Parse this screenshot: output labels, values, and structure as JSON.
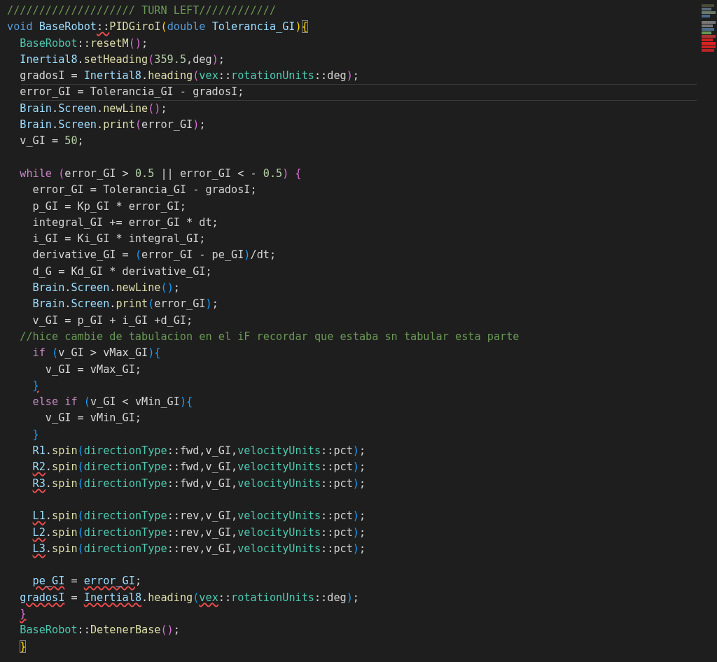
{
  "editor": {
    "lines": [
      {
        "kind": "top",
        "current": false,
        "tokens": [
          {
            "t": "//////////////////// TURN LEFT////////////",
            "kind": "comment"
          }
        ]
      },
      {
        "kind": "top",
        "current": false,
        "tokens": [
          {
            "t": "void",
            "kind": "keyword"
          },
          {
            "t": " BaseRobot",
            "kind": "variable"
          },
          {
            "t": "::",
            "kind": "plain",
            "error": true
          },
          {
            "t": "PIDGiroI",
            "kind": "function"
          },
          {
            "t": "(",
            "kind": "bracket1"
          },
          {
            "t": "double",
            "kind": "keyword"
          },
          {
            "t": " Tolerancia_GI",
            "kind": "variable"
          },
          {
            "t": ")",
            "kind": "bracket1"
          },
          {
            "t": "{",
            "kind": "bracket1",
            "matched": true
          }
        ]
      },
      {
        "kind": "body",
        "current": false,
        "tokens": [
          {
            "t": "BaseRobot",
            "kind": "type"
          },
          {
            "t": "::",
            "kind": "plain"
          },
          {
            "t": "resetM",
            "kind": "function"
          },
          {
            "t": "()",
            "kind": "bracket2"
          },
          {
            "t": ";",
            "kind": "plain"
          }
        ]
      },
      {
        "kind": "body",
        "current": false,
        "tokens": [
          {
            "t": "Inertial8",
            "kind": "variable"
          },
          {
            "t": ".",
            "kind": "plain"
          },
          {
            "t": "setHeading",
            "kind": "function"
          },
          {
            "t": "(",
            "kind": "bracket2"
          },
          {
            "t": "359.5",
            "kind": "number"
          },
          {
            "t": ",deg",
            "kind": "plain"
          },
          {
            "t": ")",
            "kind": "bracket2"
          },
          {
            "t": ";",
            "kind": "plain"
          }
        ]
      },
      {
        "kind": "body",
        "current": false,
        "tokens": [
          {
            "t": "gradosI = ",
            "kind": "plain"
          },
          {
            "t": "Inertial8",
            "kind": "variable"
          },
          {
            "t": ".",
            "kind": "plain"
          },
          {
            "t": "heading",
            "kind": "function"
          },
          {
            "t": "(",
            "kind": "bracket2"
          },
          {
            "t": "vex",
            "kind": "type"
          },
          {
            "t": "::",
            "kind": "plain"
          },
          {
            "t": "rotationUnits",
            "kind": "type"
          },
          {
            "t": "::deg",
            "kind": "plain"
          },
          {
            "t": ")",
            "kind": "bracket2"
          },
          {
            "t": ";",
            "kind": "plain"
          }
        ]
      },
      {
        "kind": "body",
        "current": true,
        "tokens": [
          {
            "t": "error_GI = Tolerancia_GI - gradosI;",
            "kind": "plain"
          }
        ]
      },
      {
        "kind": "body",
        "current": false,
        "tokens": [
          {
            "t": "Brain",
            "kind": "variable"
          },
          {
            "t": ".",
            "kind": "plain"
          },
          {
            "t": "Screen",
            "kind": "variable"
          },
          {
            "t": ".",
            "kind": "plain"
          },
          {
            "t": "newLine",
            "kind": "function"
          },
          {
            "t": "()",
            "kind": "bracket2"
          },
          {
            "t": ";",
            "kind": "plain"
          }
        ]
      },
      {
        "kind": "body",
        "current": false,
        "tokens": [
          {
            "t": "Brain",
            "kind": "variable"
          },
          {
            "t": ".",
            "kind": "plain"
          },
          {
            "t": "Screen",
            "kind": "variable"
          },
          {
            "t": ".",
            "kind": "plain"
          },
          {
            "t": "print",
            "kind": "function"
          },
          {
            "t": "(",
            "kind": "bracket2"
          },
          {
            "t": "error_GI",
            "kind": "plain"
          },
          {
            "t": ")",
            "kind": "bracket2"
          },
          {
            "t": ";",
            "kind": "plain"
          }
        ]
      },
      {
        "kind": "body",
        "current": false,
        "tokens": [
          {
            "t": "v_GI = ",
            "kind": "plain"
          },
          {
            "t": "50",
            "kind": "number"
          },
          {
            "t": ";",
            "kind": "plain"
          }
        ]
      },
      {
        "kind": "top",
        "current": false
      },
      {
        "kind": "body",
        "current": false,
        "tokens": [
          {
            "t": "while",
            "kind": "control"
          },
          {
            "t": " (",
            "kind": "bracket2"
          },
          {
            "t": "error_GI > ",
            "kind": "plain"
          },
          {
            "t": "0.5",
            "kind": "number"
          },
          {
            "t": " || error_GI < - ",
            "kind": "plain"
          },
          {
            "t": "0.5",
            "kind": "number"
          },
          {
            "t": ")",
            "kind": "bracket2"
          },
          {
            "t": " {",
            "kind": "bracket2"
          }
        ]
      },
      {
        "kind": "loop",
        "current": false,
        "tokens": [
          {
            "t": "error_GI = Tolerancia_GI - gradosI;",
            "kind": "plain"
          }
        ]
      },
      {
        "kind": "loop",
        "current": false,
        "tokens": [
          {
            "t": "p_GI = Kp_GI * error_GI;",
            "kind": "plain"
          }
        ]
      },
      {
        "kind": "loop",
        "current": false,
        "tokens": [
          {
            "t": "integral_GI += error_GI * dt;",
            "kind": "plain"
          }
        ]
      },
      {
        "kind": "loop",
        "current": false,
        "tokens": [
          {
            "t": "i_GI = Ki_GI * integral_GI;",
            "kind": "plain"
          }
        ]
      },
      {
        "kind": "loop",
        "current": false,
        "tokens": [
          {
            "t": "derivative_GI = ",
            "kind": "plain"
          },
          {
            "t": "(",
            "kind": "bracket3"
          },
          {
            "t": "error_GI - pe_GI",
            "kind": "plain"
          },
          {
            "t": ")",
            "kind": "bracket3"
          },
          {
            "t": "/dt;",
            "kind": "plain"
          }
        ]
      },
      {
        "kind": "loop",
        "current": false,
        "tokens": [
          {
            "t": "d_G = Kd_GI * derivative_GI;",
            "kind": "plain"
          }
        ]
      },
      {
        "kind": "loop",
        "current": false,
        "tokens": [
          {
            "t": "Brain",
            "kind": "variable"
          },
          {
            "t": ".",
            "kind": "plain"
          },
          {
            "t": "Screen",
            "kind": "variable"
          },
          {
            "t": ".",
            "kind": "plain"
          },
          {
            "t": "newLine",
            "kind": "function"
          },
          {
            "t": "()",
            "kind": "bracket3"
          },
          {
            "t": ";",
            "kind": "plain"
          }
        ]
      },
      {
        "kind": "loop",
        "current": false,
        "tokens": [
          {
            "t": "Brain",
            "kind": "variable"
          },
          {
            "t": ".",
            "kind": "plain"
          },
          {
            "t": "Screen",
            "kind": "variable"
          },
          {
            "t": ".",
            "kind": "plain"
          },
          {
            "t": "print",
            "kind": "function"
          },
          {
            "t": "(",
            "kind": "bracket3"
          },
          {
            "t": "error_GI",
            "kind": "plain"
          },
          {
            "t": ")",
            "kind": "bracket3"
          },
          {
            "t": ";",
            "kind": "plain"
          }
        ]
      },
      {
        "kind": "loop",
        "current": false,
        "tokens": [
          {
            "t": "v_GI = p_GI + i_GI +d_GI;",
            "kind": "plain"
          }
        ]
      },
      {
        "kind": "body",
        "current": false,
        "tokens": [
          {
            "t": "//hice cambie de tabulacion en el iF recordar que estaba sn tabular esta parte",
            "kind": "comment"
          }
        ]
      },
      {
        "kind": "loop",
        "current": false,
        "tokens": [
          {
            "t": "if",
            "kind": "control"
          },
          {
            "t": " (",
            "kind": "bracket3"
          },
          {
            "t": "v_GI > vMax_GI",
            "kind": "plain"
          },
          {
            "t": ")",
            "kind": "bracket3"
          },
          {
            "t": "{",
            "kind": "bracket3"
          }
        ]
      },
      {
        "kind": "branch",
        "current": false,
        "tokens": [
          {
            "t": "v_GI = vMax_GI;",
            "kind": "plain"
          }
        ]
      },
      {
        "kind": "loop",
        "current": false,
        "tokens": [
          {
            "t": "}",
            "kind": "bracket3",
            "error": true
          }
        ]
      },
      {
        "kind": "loop",
        "current": false,
        "tokens": [
          {
            "t": "else if",
            "kind": "control"
          },
          {
            "t": " (",
            "kind": "bracket3"
          },
          {
            "t": "v_GI < vMin_GI",
            "kind": "plain"
          },
          {
            "t": ")",
            "kind": "bracket3"
          },
          {
            "t": "{",
            "kind": "bracket3"
          }
        ]
      },
      {
        "kind": "branch",
        "current": false,
        "tokens": [
          {
            "t": "v_GI = vMin_GI;",
            "kind": "plain"
          }
        ]
      },
      {
        "kind": "loop",
        "current": false,
        "tokens": [
          {
            "t": "}",
            "kind": "bracket3"
          }
        ]
      },
      {
        "kind": "loop",
        "current": false,
        "tokens": [
          {
            "t": "R1",
            "kind": "variable"
          },
          {
            "t": ".",
            "kind": "plain"
          },
          {
            "t": "spin",
            "kind": "function"
          },
          {
            "t": "(",
            "kind": "bracket3"
          },
          {
            "t": "directionType",
            "kind": "type"
          },
          {
            "t": "::fwd,v_GI,",
            "kind": "plain"
          },
          {
            "t": "velocityUnits",
            "kind": "type"
          },
          {
            "t": "::pct",
            "kind": "plain"
          },
          {
            "t": ")",
            "kind": "bracket3"
          },
          {
            "t": ";",
            "kind": "plain"
          }
        ]
      },
      {
        "kind": "loop",
        "current": false,
        "tokens": [
          {
            "t": "R2",
            "kind": "variable",
            "error": true
          },
          {
            "t": ".",
            "kind": "plain"
          },
          {
            "t": "spin",
            "kind": "function"
          },
          {
            "t": "(",
            "kind": "bracket3"
          },
          {
            "t": "directionType",
            "kind": "type"
          },
          {
            "t": "::fwd,v_GI,",
            "kind": "plain"
          },
          {
            "t": "velocityUnits",
            "kind": "type"
          },
          {
            "t": "::pct",
            "kind": "plain"
          },
          {
            "t": ")",
            "kind": "bracket3"
          },
          {
            "t": ";",
            "kind": "plain"
          }
        ]
      },
      {
        "kind": "loop",
        "current": false,
        "tokens": [
          {
            "t": "R3",
            "kind": "variable",
            "error": true
          },
          {
            "t": ".",
            "kind": "plain"
          },
          {
            "t": "spin",
            "kind": "function"
          },
          {
            "t": "(",
            "kind": "bracket3"
          },
          {
            "t": "directionType",
            "kind": "type"
          },
          {
            "t": "::fwd,v_GI,",
            "kind": "plain"
          },
          {
            "t": "velocityUnits",
            "kind": "type"
          },
          {
            "t": "::pct",
            "kind": "plain"
          },
          {
            "t": ")",
            "kind": "bracket3"
          },
          {
            "t": ";",
            "kind": "plain"
          }
        ]
      },
      {
        "kind": "top",
        "current": false
      },
      {
        "kind": "loop",
        "current": false,
        "tokens": [
          {
            "t": "L1",
            "kind": "variable",
            "error": true
          },
          {
            "t": ".",
            "kind": "plain"
          },
          {
            "t": "spin",
            "kind": "function"
          },
          {
            "t": "(",
            "kind": "bracket3"
          },
          {
            "t": "directionType",
            "kind": "type"
          },
          {
            "t": "::rev,v_GI,",
            "kind": "plain"
          },
          {
            "t": "velocityUnits",
            "kind": "type"
          },
          {
            "t": "::pct",
            "kind": "plain"
          },
          {
            "t": ")",
            "kind": "bracket3"
          },
          {
            "t": ";",
            "kind": "plain"
          }
        ]
      },
      {
        "kind": "loop",
        "current": false,
        "tokens": [
          {
            "t": "L2",
            "kind": "variable",
            "error": true
          },
          {
            "t": ".",
            "kind": "plain"
          },
          {
            "t": "spin",
            "kind": "function"
          },
          {
            "t": "(",
            "kind": "bracket3"
          },
          {
            "t": "directionType",
            "kind": "type"
          },
          {
            "t": "::rev,v_GI,",
            "kind": "plain"
          },
          {
            "t": "velocityUnits",
            "kind": "type"
          },
          {
            "t": "::pct",
            "kind": "plain"
          },
          {
            "t": ")",
            "kind": "bracket3"
          },
          {
            "t": ";",
            "kind": "plain"
          }
        ]
      },
      {
        "kind": "loop",
        "current": false,
        "tokens": [
          {
            "t": "L3",
            "kind": "variable",
            "error": true
          },
          {
            "t": ".",
            "kind": "plain"
          },
          {
            "t": "spin",
            "kind": "function"
          },
          {
            "t": "(",
            "kind": "bracket3"
          },
          {
            "t": "directionType",
            "kind": "type"
          },
          {
            "t": "::rev,v_GI,",
            "kind": "plain"
          },
          {
            "t": "velocityUnits",
            "kind": "type"
          },
          {
            "t": "::pct",
            "kind": "plain"
          },
          {
            "t": ")",
            "kind": "bracket3"
          },
          {
            "t": ";",
            "kind": "plain"
          }
        ]
      },
      {
        "kind": "top",
        "current": false
      },
      {
        "kind": "loop",
        "current": false,
        "tokens": [
          {
            "t": "pe_GI",
            "kind": "variable",
            "error": true
          },
          {
            "t": " = ",
            "kind": "plain"
          },
          {
            "t": "error_GI",
            "kind": "variable",
            "error": true
          },
          {
            "t": ";",
            "kind": "plain"
          }
        ]
      },
      {
        "kind": "body",
        "current": false,
        "tokens": [
          {
            "t": "gradosI",
            "kind": "variable",
            "error": true
          },
          {
            "t": " = ",
            "kind": "plain"
          },
          {
            "t": "Inertial8",
            "kind": "variable",
            "error": true
          },
          {
            "t": ".",
            "kind": "plain"
          },
          {
            "t": "heading",
            "kind": "function"
          },
          {
            "t": "(",
            "kind": "bracket3"
          },
          {
            "t": "vex",
            "kind": "type",
            "error": true
          },
          {
            "t": "::",
            "kind": "plain"
          },
          {
            "t": "rotationUnits",
            "kind": "type"
          },
          {
            "t": "::deg",
            "kind": "plain"
          },
          {
            "t": ")",
            "kind": "bracket3"
          },
          {
            "t": ";",
            "kind": "plain"
          }
        ]
      },
      {
        "kind": "body",
        "current": false,
        "tokens": [
          {
            "t": "}",
            "kind": "bracket2",
            "error": true
          }
        ]
      },
      {
        "kind": "body",
        "current": false,
        "tokens": [
          {
            "t": "BaseRobot",
            "kind": "type"
          },
          {
            "t": "::",
            "kind": "plain"
          },
          {
            "t": "DetenerBase",
            "kind": "function"
          },
          {
            "t": "()",
            "kind": "bracket2"
          },
          {
            "t": ";",
            "kind": "plain"
          }
        ]
      },
      {
        "kind": "body",
        "current": false,
        "tokens": [
          {
            "t": "}",
            "kind": "bracket1",
            "matched": true
          }
        ]
      }
    ]
  }
}
